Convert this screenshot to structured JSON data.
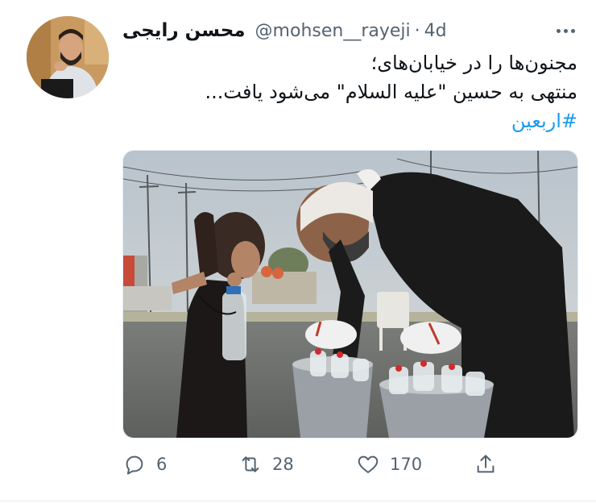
{
  "tweet": {
    "author_name": "محسن رایجی",
    "handle": "@mohsen__rayeji",
    "separator": "·",
    "time": "4d",
    "text_lines": [
      "مجنون‌ها را در خیابان‌های؛",
      "منتهی به حسین \"علیه السلام\" می‌شود یافت..."
    ],
    "hashtag": "#اربعین"
  },
  "actions": {
    "replies": "6",
    "retweets": "28",
    "likes": "170"
  },
  "icons": {
    "reply": "reply-icon",
    "retweet": "retweet-icon",
    "like": "heart-icon",
    "share": "share-icon",
    "more": "more-icon"
  },
  "colors": {
    "text": "#0f1419",
    "secondary": "#536471",
    "link": "#1d9bf0"
  }
}
